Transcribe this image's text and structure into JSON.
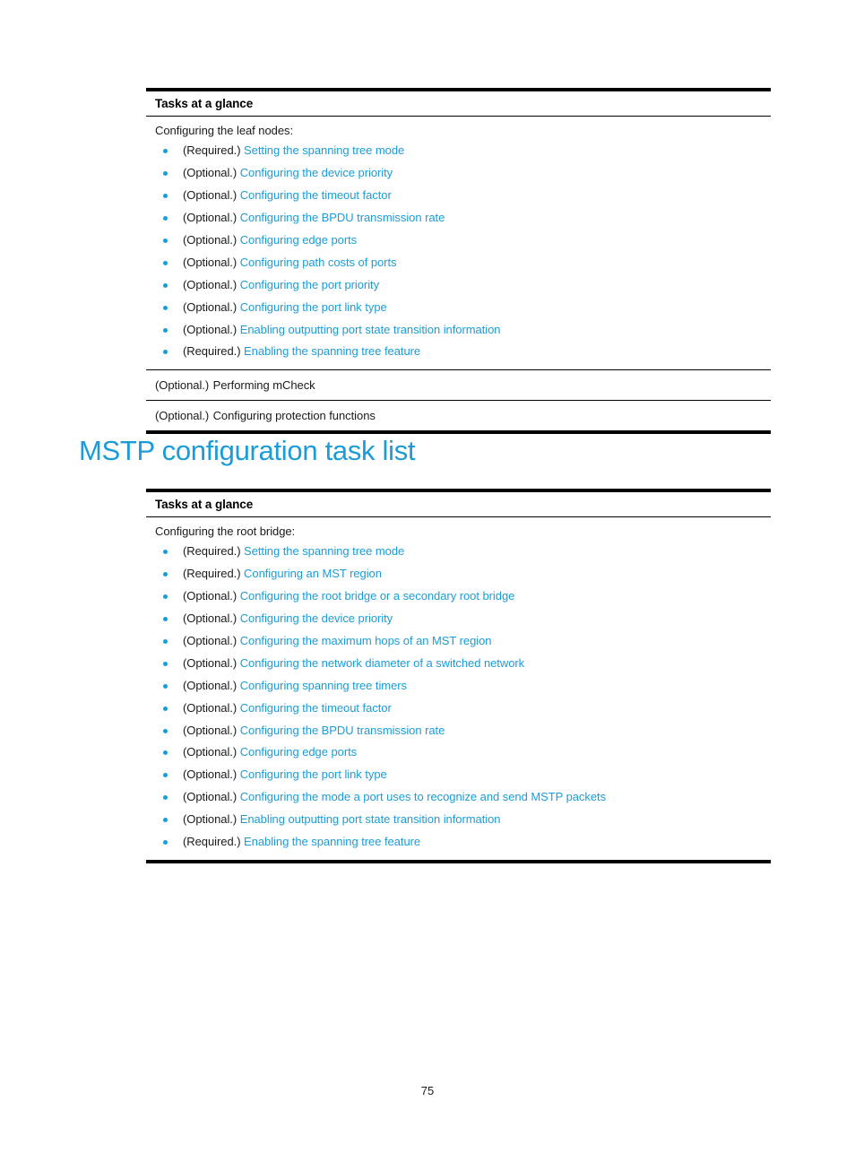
{
  "document": {
    "page_number": "75",
    "accent_color": "#1b9cd8",
    "text_color": "#1a1a1a"
  },
  "heading": {
    "text": "MSTP configuration task list"
  },
  "tables": [
    {
      "header": "Tasks at a glance",
      "rows": [
        {
          "intro": "Configuring the leaf nodes:",
          "items": [
            {
              "qualifier": "(Required.)",
              "link": "Setting the spanning tree mode"
            },
            {
              "qualifier": "(Optional.)",
              "link": "Configuring the device priority"
            },
            {
              "qualifier": "(Optional.)",
              "link": "Configuring the timeout factor"
            },
            {
              "qualifier": "(Optional.)",
              "link": "Configuring the BPDU transmission rate"
            },
            {
              "qualifier": "(Optional.)",
              "link": "Configuring edge ports"
            },
            {
              "qualifier": "(Optional.)",
              "link": "Configuring path costs of ports"
            },
            {
              "qualifier": "(Optional.)",
              "link": "Configuring the port priority"
            },
            {
              "qualifier": "(Optional.)",
              "link": "Configuring the port link type"
            },
            {
              "qualifier": "(Optional.)",
              "link": "Enabling outputting port state transition information"
            },
            {
              "qualifier": "(Required.)",
              "link": "Enabling the spanning tree feature"
            }
          ]
        },
        {
          "qualifier": "(Optional.)",
          "link": "Performing mCheck"
        },
        {
          "qualifier": "(Optional.)",
          "link": "Configuring protection functions"
        }
      ]
    },
    {
      "header": "Tasks at a glance",
      "rows": [
        {
          "intro": "Configuring the root bridge:",
          "items": [
            {
              "qualifier": "(Required.)",
              "link": "Setting the spanning tree mode"
            },
            {
              "qualifier": "(Required.)",
              "link": "Configuring an MST region"
            },
            {
              "qualifier": "(Optional.)",
              "link": "Configuring the root bridge or a secondary root bridge"
            },
            {
              "qualifier": "(Optional.)",
              "link": "Configuring the device priority"
            },
            {
              "qualifier": "(Optional.)",
              "link": "Configuring the maximum hops of an MST region"
            },
            {
              "qualifier": "(Optional.)",
              "link": "Configuring the network diameter of a switched network"
            },
            {
              "qualifier": "(Optional.)",
              "link": "Configuring spanning tree timers"
            },
            {
              "qualifier": "(Optional.)",
              "link": "Configuring the timeout factor"
            },
            {
              "qualifier": "(Optional.)",
              "link": "Configuring the BPDU transmission rate"
            },
            {
              "qualifier": "(Optional.)",
              "link": "Configuring edge ports"
            },
            {
              "qualifier": "(Optional.)",
              "link": "Configuring the port link type"
            },
            {
              "qualifier": "(Optional.)",
              "link": "Configuring the mode a port uses to recognize and send MSTP packets"
            },
            {
              "qualifier": "(Optional.)",
              "link": "Enabling outputting port state transition information"
            },
            {
              "qualifier": "(Required.)",
              "link": "Enabling the spanning tree feature"
            }
          ]
        }
      ]
    }
  ]
}
